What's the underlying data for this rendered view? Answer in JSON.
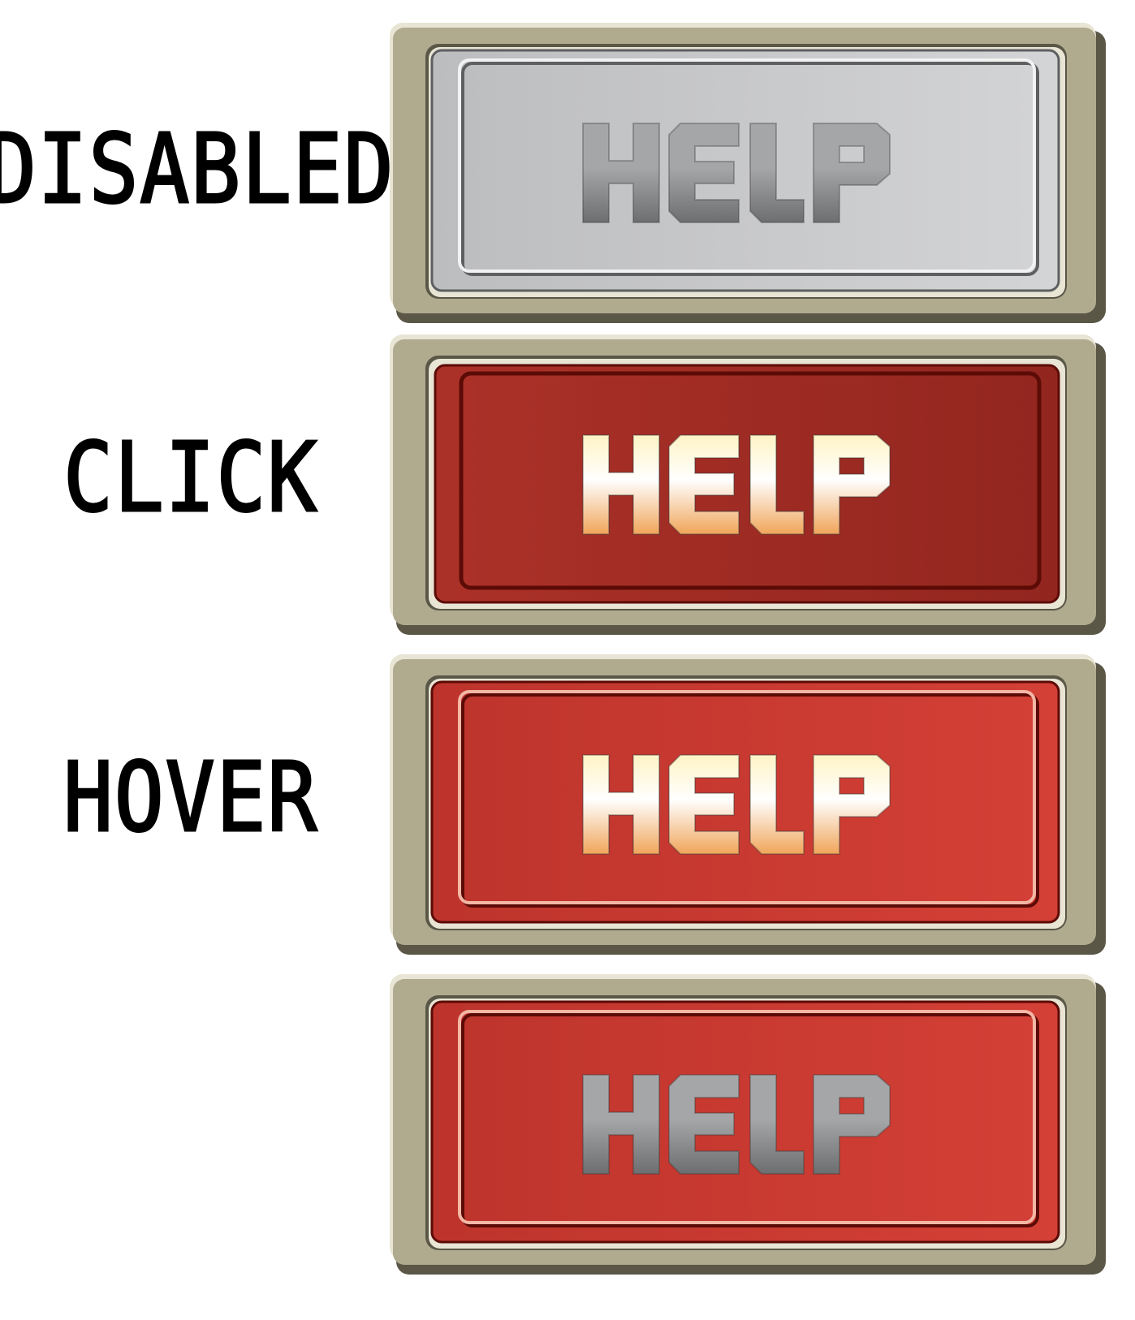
{
  "rows": [
    {
      "state_label": "DISABLED",
      "button_text": "HELP",
      "style": "disabled",
      "colors": {
        "face_left": "#bcbdbf",
        "face_right": "#d3d4d6",
        "text_top": "#a5a6a8",
        "text_bottom": "#6d6e70",
        "inner_line": "#f2f2f2",
        "inner_shadow": "#5e5f61"
      }
    },
    {
      "state_label": "CLICK",
      "button_text": "HELP",
      "style": "click",
      "colors": {
        "face_left": "#ab3128",
        "face_right": "#92261f",
        "text_top": "#fff3c4",
        "text_bottom": "#f0a55a",
        "inner_line": "#b83a30",
        "inner_shadow": "#5c0b06"
      }
    },
    {
      "state_label": "HOVER",
      "button_text": "HELP",
      "style": "hover",
      "colors": {
        "face_left": "#bd342c",
        "face_right": "#d44036",
        "text_top": "#fff3c4",
        "text_bottom": "#f0a55a",
        "inner_line": "#f3b7a6",
        "inner_shadow": "#5c0b06"
      }
    },
    {
      "state_label": "",
      "button_text": "HELP",
      "style": "normal",
      "colors": {
        "face_left": "#bd342c",
        "face_right": "#d44036",
        "text_top": "#a5a6a8",
        "text_bottom": "#6d6e70",
        "inner_line": "#f3b7a6",
        "inner_shadow": "#5c0b06"
      }
    }
  ],
  "frame_colors": {
    "bezel": "#b0aa8f",
    "bezel_dark": "#5a5747",
    "bezel_light": "#e8e5d5"
  }
}
